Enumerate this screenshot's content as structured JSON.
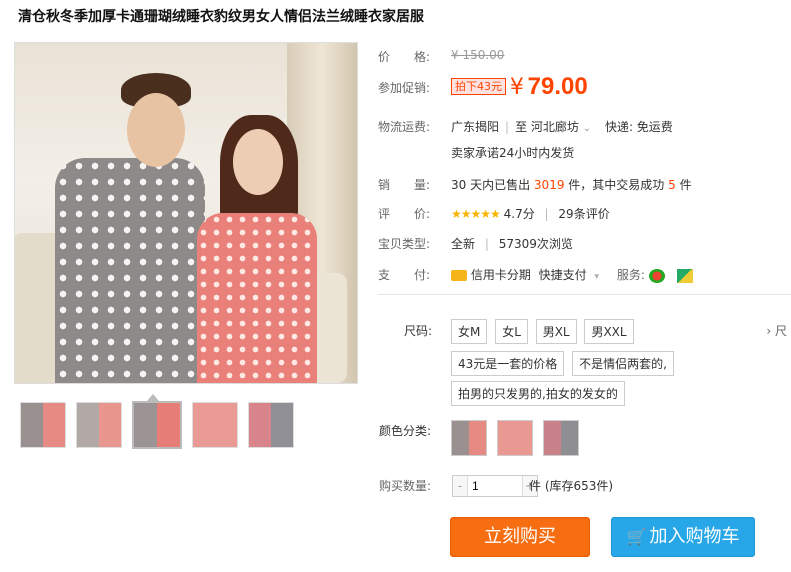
{
  "title": "清仓秋冬季加厚卡通珊瑚绒睡衣豹纹男女人情侣法兰绒睡衣家居服",
  "price": {
    "label": "价　　格:",
    "original": "¥ 150.00"
  },
  "promo": {
    "label": "参加促销:",
    "tag": "拍下43元",
    "currency": "¥",
    "value": "79.00"
  },
  "shipping": {
    "label": "物流运费:",
    "from": "广东揭阳",
    "to": "河北廊坊",
    "fee": "快递: 免运费",
    "promise": "卖家承诺24小时内发货"
  },
  "sales": {
    "label": "销　　量:",
    "prefix": "30 天内已售出",
    "sold": "3019",
    "mid": "件，其中交易成功",
    "success": "5",
    "unit": "件"
  },
  "rating": {
    "label": "评　　价:",
    "stars": "★★★★★",
    "score": "4.7分",
    "reviews": "29条评价"
  },
  "item_type": {
    "label": "宝贝类型:",
    "condition": "全新",
    "views": "57309次浏览"
  },
  "payment": {
    "label": "支　　付:",
    "method1": "信用卡分期",
    "method2": "快捷支付",
    "service": "服务:"
  },
  "size": {
    "label": "尺码:",
    "options": [
      "女M",
      "女L",
      "男XL",
      "男XXL"
    ],
    "notes": [
      "43元是一套的价格",
      "不是情侣两套的,",
      "拍男的只发男的,拍女的发女的"
    ],
    "more": "› 尺"
  },
  "color": {
    "label": "颜色分类:"
  },
  "quantity": {
    "label": "购买数量:",
    "value": "1",
    "unit": "件",
    "stock": "(库存653件)",
    "minus": "-",
    "plus": "+"
  },
  "buttons": {
    "buy": "立刻购买",
    "cart": "加入购物车"
  }
}
